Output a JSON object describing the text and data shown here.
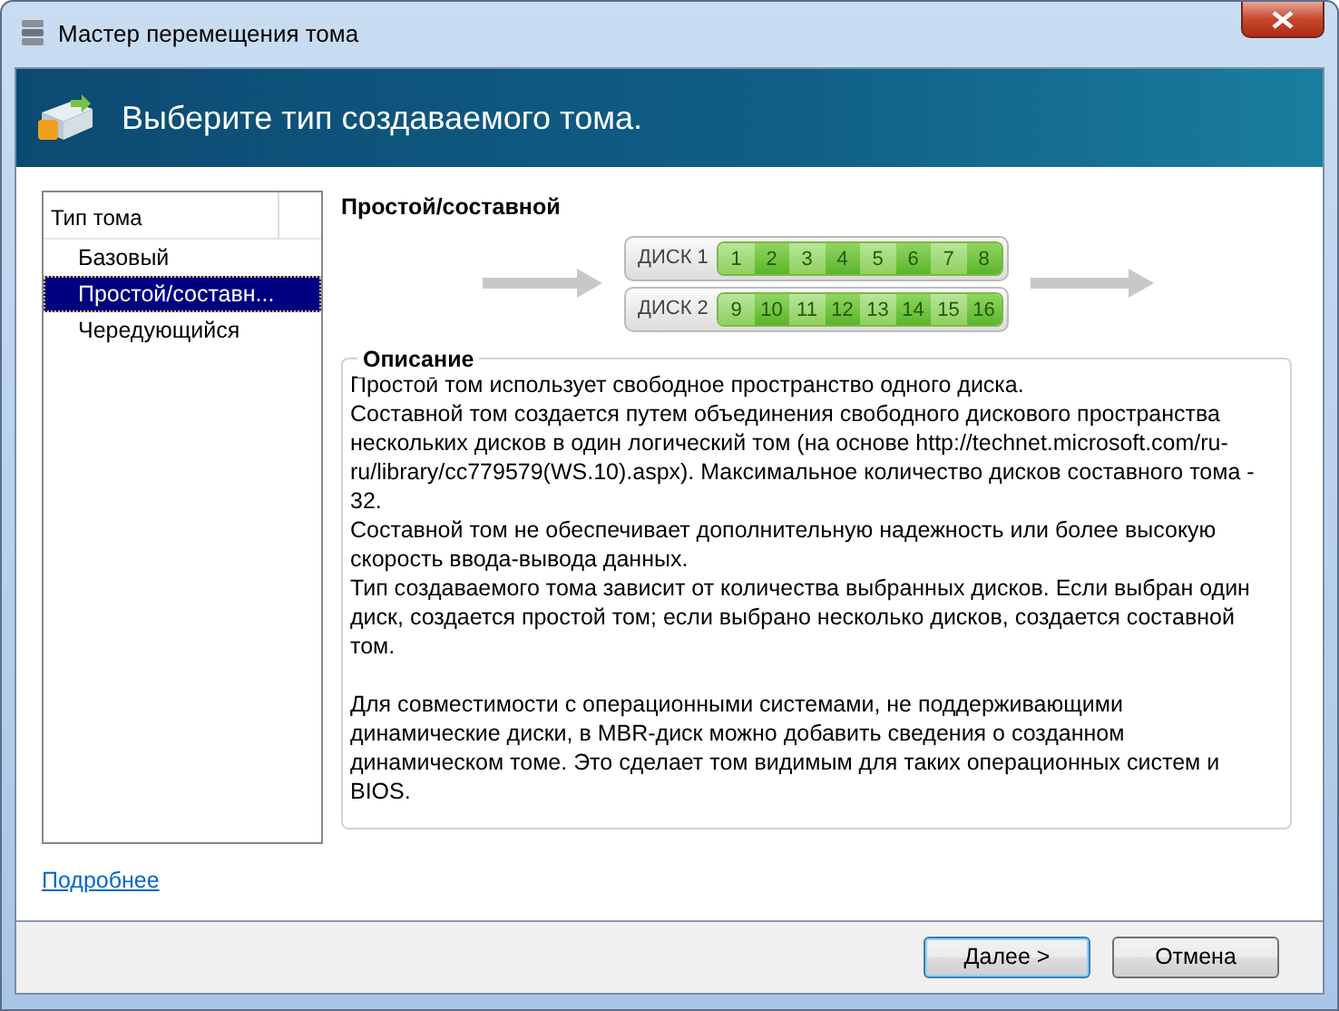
{
  "window": {
    "title": "Мастер перемещения тома"
  },
  "header": {
    "title": "Выберите тип создаваемого тома."
  },
  "volume_types": {
    "column": "Тип тома",
    "items": [
      {
        "label": "Базовый",
        "selected": false
      },
      {
        "label": "Простой/составн...",
        "selected": true
      },
      {
        "label": "Чередующийся",
        "selected": false
      }
    ]
  },
  "detail": {
    "title": "Простой/составной",
    "disks": [
      {
        "label": "ДИСК 1",
        "segments": [
          "1",
          "2",
          "3",
          "4",
          "5",
          "6",
          "7",
          "8"
        ]
      },
      {
        "label": "ДИСК 2",
        "segments": [
          "9",
          "10",
          "11",
          "12",
          "13",
          "14",
          "15",
          "16"
        ]
      }
    ],
    "description": {
      "title": "Описание",
      "sections": [
        {
          "lines": [
            "Простой том использует свободное пространство одного диска.",
            "Составной том создается путем объединения свободного дискового пространства нескольких дисков в один логический том (на основе http://technet.microsoft.com/ru-ru/library/cc779579(WS.10).aspx). Максимальное количество дисков составного тома - 32.",
            "Составной том не обеспечивает дополнительную надежность или более высокую скорость ввода-вывода данных.",
            "Тип создаваемого тома зависит от количества выбранных дисков. Если выбран один диск, создается простой том; если выбрано несколько дисков, создается составной том."
          ]
        },
        {
          "lines": [
            "Для совместимости с операционными системами, не поддерживающими динамические диски, в MBR-диск можно добавить сведения о созданном динамическом томе. Это сделает том видимым для таких операционных систем и BIOS."
          ]
        }
      ]
    }
  },
  "more_link": "Подробнее",
  "buttons": [
    {
      "label": "Далее >",
      "default": true
    },
    {
      "label": "Отмена",
      "default": false
    }
  ]
}
